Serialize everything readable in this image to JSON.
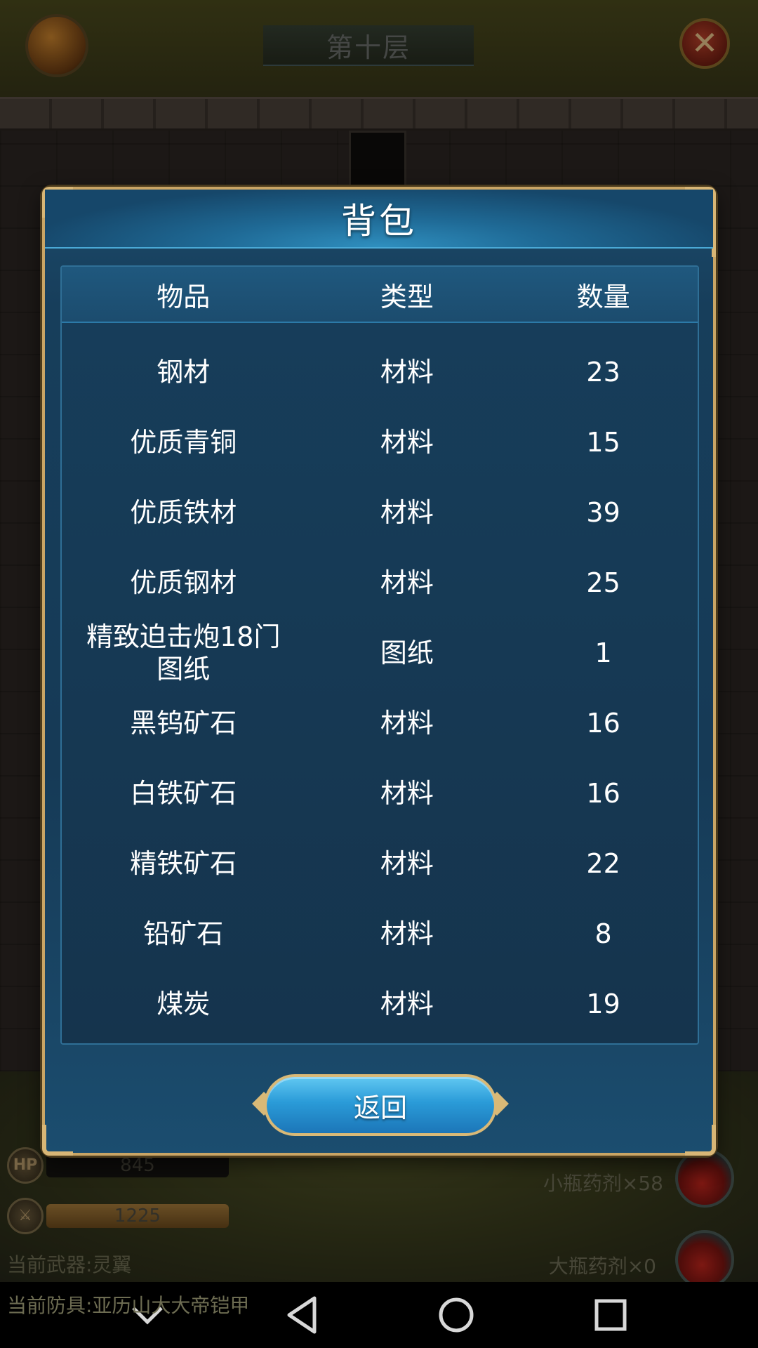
{
  "game": {
    "floor_title": "第十层",
    "hp_label": "HP",
    "hp_value": "845",
    "atk_value": "1225",
    "weapon_text": "当前武器:灵翼",
    "armor_text": "当前防具:亚历山大大帝铠甲",
    "small_potion": "小瓶药剂×58",
    "large_potion": "大瓶药剂×0"
  },
  "dialog": {
    "title": "背包",
    "columns": [
      "物品",
      "类型",
      "数量"
    ],
    "rows": [
      {
        "item": "钢材",
        "type": "材料",
        "qty": "23"
      },
      {
        "item": "优质青铜",
        "type": "材料",
        "qty": "15"
      },
      {
        "item": "优质铁材",
        "type": "材料",
        "qty": "39"
      },
      {
        "item": "优质钢材",
        "type": "材料",
        "qty": "25"
      },
      {
        "item": "精致迫击炮18门图纸",
        "type": "图纸",
        "qty": "1"
      },
      {
        "item": "黑钨矿石",
        "type": "材料",
        "qty": "16"
      },
      {
        "item": "白铁矿石",
        "type": "材料",
        "qty": "16"
      },
      {
        "item": "精铁矿石",
        "type": "材料",
        "qty": "22"
      },
      {
        "item": "铅矿石",
        "type": "材料",
        "qty": "8"
      },
      {
        "item": "煤炭",
        "type": "材料",
        "qty": "19"
      }
    ],
    "return_label": "返回"
  },
  "icons": {
    "close": "close-icon",
    "bag": "bag-icon",
    "nav_back": "back-icon",
    "nav_home": "home-icon",
    "nav_recent": "recent-apps-icon",
    "nav_collapse": "chevron-down-icon"
  },
  "colors": {
    "dialog_bg": "#173e5b",
    "dialog_border": "#c9a565",
    "button_blue": "#2a9bd8"
  }
}
